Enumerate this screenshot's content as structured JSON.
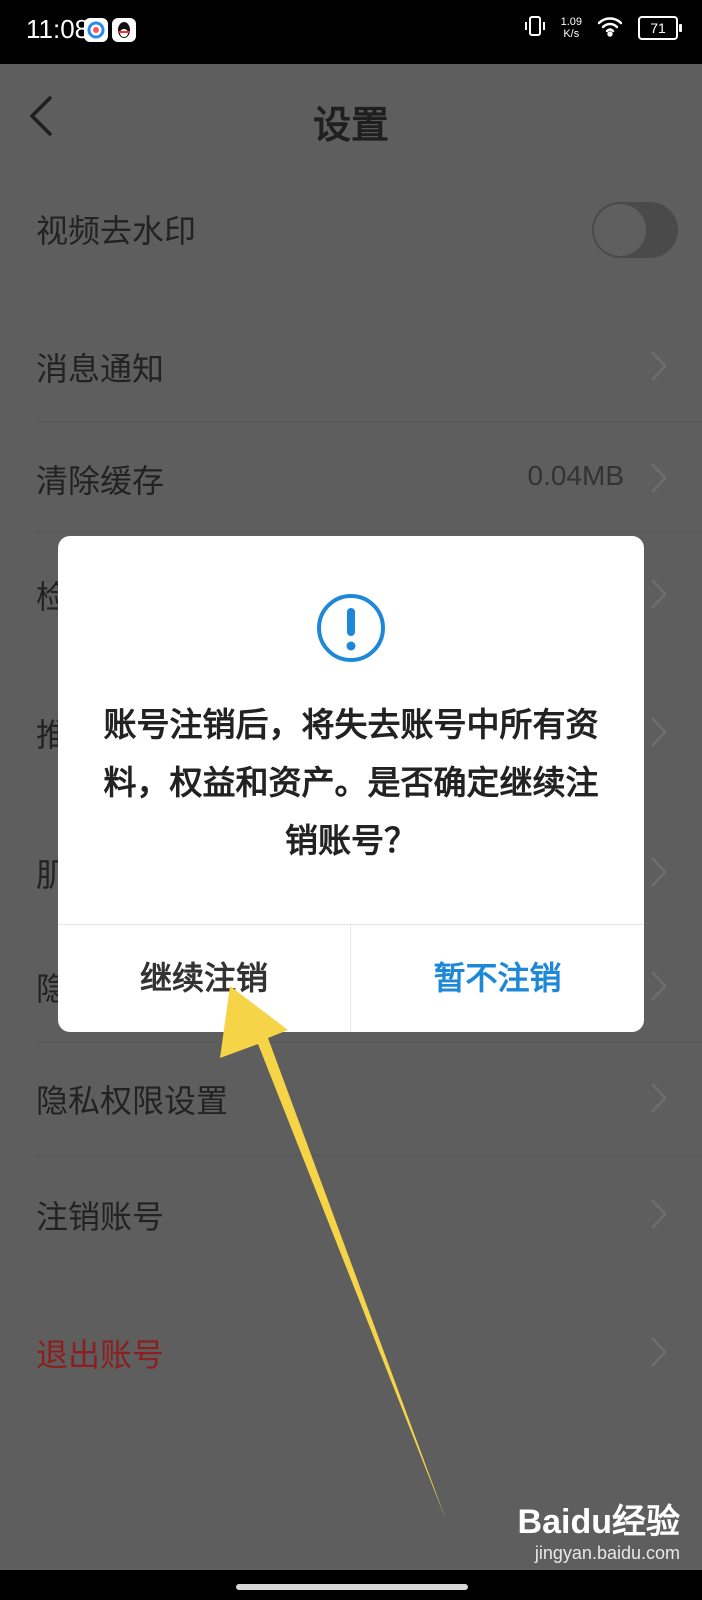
{
  "status_bar": {
    "time": "11:08",
    "speed_value": "1.09",
    "speed_unit": "K/s",
    "battery": "71"
  },
  "header": {
    "title": "设置"
  },
  "settings": {
    "watermark_label": "视频去水印",
    "watermark_toggle_on": false,
    "notifications_label": "消息通知",
    "clear_cache_label": "清除缓存",
    "cache_size": "0.04MB",
    "row4_label_visible": "检",
    "row5_label_visible": "推",
    "row6_label_visible": "肌",
    "row7_label_visible": "隐",
    "privacy_permissions_label": "隐私权限设置",
    "delete_account_label": "注销账号",
    "logout_label": "退出账号"
  },
  "dialog": {
    "icon": "exclamation-circle-icon",
    "message": "账号注销后，将失去账号中所有资料，权益和资产。是否确定继续注销账号？",
    "confirm_label": "继续注销",
    "cancel_label": "暂不注销"
  },
  "watermark": {
    "logo": "Baidu经验",
    "url": "jingyan.baidu.com"
  },
  "colors": {
    "overlay_background": "#5e5e5e",
    "accent_blue": "#1e88d8",
    "logout_red": "#8c1f1f",
    "annotation_arrow": "#f5d547"
  }
}
